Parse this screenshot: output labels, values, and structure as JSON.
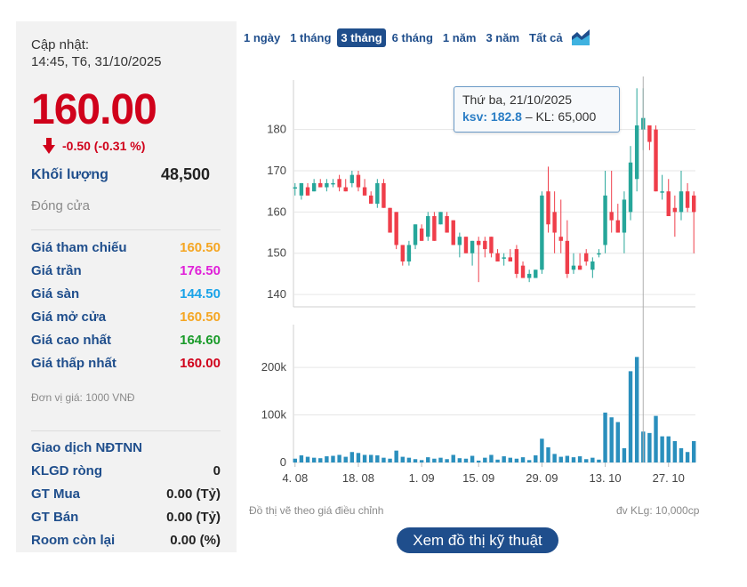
{
  "panel": {
    "updated_label": "Cập nhật:",
    "updated_time": "14:45, T6, 31/10/2025",
    "price": "160.00",
    "change": "-0.50 (-0.31 %)",
    "volume_label": "Khối lượng",
    "volume_value": "48,500",
    "status": "Đóng cửa",
    "stats": [
      {
        "label": "Giá tham chiếu",
        "value": "160.50",
        "color": "#f5a623"
      },
      {
        "label": "Giá trần",
        "value": "176.50",
        "color": "#e020d8"
      },
      {
        "label": "Giá sàn",
        "value": "144.50",
        "color": "#1aa3e8"
      },
      {
        "label": "Giá mở cửa",
        "value": "160.50",
        "color": "#f5a623"
      },
      {
        "label": "Giá cao nhất",
        "value": "164.60",
        "color": "#1a9b2a"
      },
      {
        "label": "Giá thấp nhất",
        "value": "160.00",
        "color": "#d0021b"
      }
    ],
    "unit_note": "Đơn vị giá: 1000 VNĐ",
    "foreign": {
      "title": "Giao dịch NĐTNN",
      "rows": [
        {
          "label": "KLGD ròng",
          "value": "0"
        },
        {
          "label": "GT Mua",
          "value": "0.00 (Tỷ)"
        },
        {
          "label": "GT Bán",
          "value": "0.00 (Tỷ)"
        },
        {
          "label": "Room còn lại",
          "value": "0.00 (%)"
        }
      ]
    }
  },
  "tabs": [
    "1 ngày",
    "1 tháng",
    "3 tháng",
    "6 tháng",
    "1 năm",
    "3 năm",
    "Tất cả"
  ],
  "active_tab": "3 tháng",
  "tooltip": {
    "date": "Thứ ba, 21/10/2025",
    "key": "ksv: 182.8",
    "rest": " – KL: 65,000"
  },
  "footnote_left": "Đồ thị vẽ theo giá điều chỉnh",
  "footnote_right": "đv KLg: 10,000cp",
  "tech_button": "Xem đồ thị kỹ thuật",
  "colors": {
    "up": "#26a69a",
    "down": "#ef3e4a",
    "volume": "#2a8fbd",
    "accent": "#1f4e8c"
  },
  "chart_data": {
    "type": "candlestick",
    "price_ylim": [
      137,
      192
    ],
    "price_ticks": [
      140,
      150,
      160,
      170,
      180
    ],
    "volume_ylim": [
      0,
      290000
    ],
    "volume_ticks": [
      {
        "value": 0,
        "label": "0"
      },
      {
        "value": 100000,
        "label": "100k"
      },
      {
        "value": 200000,
        "label": "200k"
      }
    ],
    "x_tick_labels": [
      {
        "index": 0,
        "label": "4. 08"
      },
      {
        "index": 10,
        "label": "18. 08"
      },
      {
        "index": 20,
        "label": "1. 09"
      },
      {
        "index": 29,
        "label": "15. 09"
      },
      {
        "index": 39,
        "label": "29. 09"
      },
      {
        "index": 49,
        "label": "13. 10"
      },
      {
        "index": 59,
        "label": "27. 10"
      }
    ],
    "highlight_index": 55,
    "candles": [
      {
        "o": 166,
        "h": 167,
        "l": 164,
        "c": 166,
        "v": 8000
      },
      {
        "o": 164,
        "h": 167,
        "l": 163,
        "c": 167,
        "v": 15000
      },
      {
        "o": 166,
        "h": 167,
        "l": 164,
        "c": 164,
        "v": 12000
      },
      {
        "o": 165,
        "h": 168,
        "l": 165,
        "c": 167,
        "v": 10000
      },
      {
        "o": 167,
        "h": 168,
        "l": 166,
        "c": 166,
        "v": 9000
      },
      {
        "o": 166,
        "h": 168,
        "l": 165,
        "c": 167,
        "v": 13000
      },
      {
        "o": 167,
        "h": 168,
        "l": 166,
        "c": 167,
        "v": 14000
      },
      {
        "o": 168,
        "h": 169,
        "l": 165,
        "c": 166,
        "v": 16000
      },
      {
        "o": 166,
        "h": 168,
        "l": 165,
        "c": 165,
        "v": 12000
      },
      {
        "o": 167,
        "h": 170,
        "l": 166,
        "c": 169,
        "v": 22000
      },
      {
        "o": 169,
        "h": 170,
        "l": 165,
        "c": 166,
        "v": 20000
      },
      {
        "o": 166,
        "h": 168,
        "l": 164,
        "c": 164,
        "v": 16000
      },
      {
        "o": 164,
        "h": 165,
        "l": 162,
        "c": 162,
        "v": 16000
      },
      {
        "o": 162,
        "h": 168,
        "l": 161,
        "c": 167,
        "v": 15000
      },
      {
        "o": 167,
        "h": 168,
        "l": 161,
        "c": 161,
        "v": 10000
      },
      {
        "o": 161,
        "h": 161,
        "l": 155,
        "c": 155,
        "v": 8000
      },
      {
        "o": 160,
        "h": 160,
        "l": 151,
        "c": 152,
        "v": 25000
      },
      {
        "o": 152,
        "h": 152,
        "l": 147,
        "c": 148,
        "v": 12000
      },
      {
        "o": 148,
        "h": 153,
        "l": 147,
        "c": 152,
        "v": 10000
      },
      {
        "o": 152,
        "h": 157,
        "l": 151,
        "c": 157,
        "v": 7000
      },
      {
        "o": 156,
        "h": 157,
        "l": 153,
        "c": 153,
        "v": 5000
      },
      {
        "o": 154,
        "h": 160,
        "l": 153,
        "c": 159,
        "v": 11000
      },
      {
        "o": 159,
        "h": 160,
        "l": 153,
        "c": 153,
        "v": 8000
      },
      {
        "o": 157,
        "h": 160,
        "l": 157,
        "c": 160,
        "v": 10000
      },
      {
        "o": 159,
        "h": 160,
        "l": 155,
        "c": 155,
        "v": 7000
      },
      {
        "o": 158,
        "h": 158,
        "l": 152,
        "c": 152,
        "v": 16000
      },
      {
        "o": 152,
        "h": 155,
        "l": 149,
        "c": 154,
        "v": 9000
      },
      {
        "o": 154,
        "h": 154,
        "l": 150,
        "c": 150,
        "v": 8000
      },
      {
        "o": 150,
        "h": 153,
        "l": 147,
        "c": 153,
        "v": 14000
      },
      {
        "o": 153,
        "h": 154,
        "l": 143,
        "c": 152,
        "v": 4000
      },
      {
        "o": 153,
        "h": 154,
        "l": 149,
        "c": 151,
        "v": 10000
      },
      {
        "o": 154,
        "h": 154,
        "l": 149,
        "c": 150,
        "v": 16000
      },
      {
        "o": 150,
        "h": 151,
        "l": 148,
        "c": 148,
        "v": 6000
      },
      {
        "o": 149,
        "h": 150,
        "l": 147,
        "c": 149,
        "v": 13000
      },
      {
        "o": 149,
        "h": 151,
        "l": 148,
        "c": 148,
        "v": 10000
      },
      {
        "o": 151,
        "h": 152,
        "l": 144,
        "c": 145,
        "v": 8000
      },
      {
        "o": 147,
        "h": 148,
        "l": 144,
        "c": 144,
        "v": 11000
      },
      {
        "o": 144,
        "h": 146,
        "l": 143,
        "c": 145,
        "v": 5000
      },
      {
        "o": 144,
        "h": 146,
        "l": 144,
        "c": 146,
        "v": 15000
      },
      {
        "o": 146,
        "h": 165,
        "l": 145,
        "c": 164,
        "v": 50000
      },
      {
        "o": 165,
        "h": 171,
        "l": 155,
        "c": 157,
        "v": 32000
      },
      {
        "o": 160,
        "h": 165,
        "l": 150,
        "c": 155,
        "v": 18000
      },
      {
        "o": 154,
        "h": 163,
        "l": 150,
        "c": 153,
        "v": 12000
      },
      {
        "o": 153,
        "h": 158,
        "l": 144,
        "c": 145,
        "v": 14000
      },
      {
        "o": 146,
        "h": 150,
        "l": 145,
        "c": 147,
        "v": 11000
      },
      {
        "o": 147,
        "h": 150,
        "l": 146,
        "c": 146,
        "v": 13000
      },
      {
        "o": 150,
        "h": 151,
        "l": 147,
        "c": 148,
        "v": 7000
      },
      {
        "o": 146,
        "h": 149,
        "l": 144,
        "c": 148,
        "v": 10000
      },
      {
        "o": 150,
        "h": 151,
        "l": 149,
        "c": 150,
        "v": 6000
      },
      {
        "o": 152,
        "h": 170,
        "l": 150,
        "c": 164,
        "v": 105000
      },
      {
        "o": 160,
        "h": 170,
        "l": 155,
        "c": 158,
        "v": 95000
      },
      {
        "o": 158,
        "h": 162,
        "l": 155,
        "c": 155,
        "v": 85000
      },
      {
        "o": 155,
        "h": 165,
        "l": 150,
        "c": 163,
        "v": 30000
      },
      {
        "o": 160,
        "h": 176,
        "l": 158,
        "c": 172,
        "v": 192000
      },
      {
        "o": 168,
        "h": 190,
        "l": 165,
        "c": 181,
        "v": 222000
      },
      {
        "o": 180,
        "h": 190,
        "l": 175,
        "c": 182.8,
        "v": 65000
      },
      {
        "o": 181,
        "h": 181,
        "l": 175,
        "c": 177,
        "v": 62000
      },
      {
        "o": 180,
        "h": 181,
        "l": 165,
        "c": 165,
        "v": 98000
      },
      {
        "o": 165,
        "h": 169,
        "l": 163,
        "c": 165,
        "v": 55000
      },
      {
        "o": 165,
        "h": 168,
        "l": 159,
        "c": 159,
        "v": 55000
      },
      {
        "o": 161,
        "h": 164,
        "l": 154,
        "c": 160,
        "v": 45000
      },
      {
        "o": 160,
        "h": 170,
        "l": 158,
        "c": 165,
        "v": 30000
      },
      {
        "o": 165,
        "h": 167,
        "l": 160,
        "c": 161,
        "v": 22000
      },
      {
        "o": 164,
        "h": 165,
        "l": 150,
        "c": 160,
        "v": 45000
      }
    ]
  }
}
